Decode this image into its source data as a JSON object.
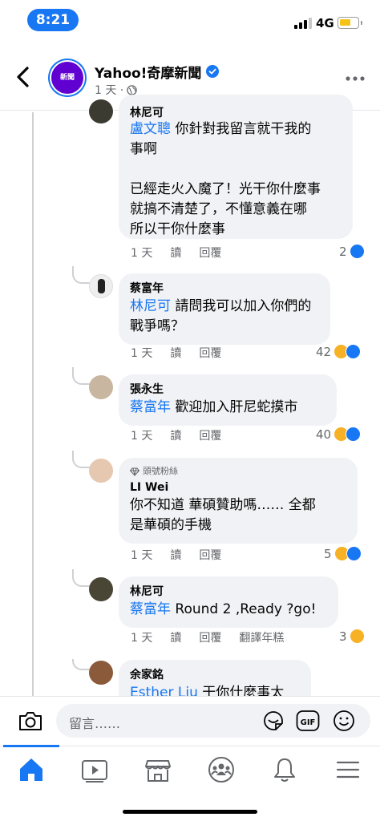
{
  "status_bar": {
    "time": "8:21",
    "network": "4G"
  },
  "header": {
    "page_name": "Yahoo!奇摩新聞",
    "avatar_text": "新聞",
    "meta": "1 天 ·"
  },
  "comments": [
    {
      "author_partial": "林尼可",
      "mention": "盧文聰",
      "text": " 你針對我留言就干我的\n事啊\n\n已經走火入魔了！光干你什麼事\n就搞不清楚了，不懂意義在哪\n所以干你什麼事",
      "time": "1 天",
      "read": "讀",
      "reply": "回覆",
      "count": "2"
    },
    {
      "author": "蔡富年",
      "mention": "林尼可",
      "text": " 請問我可以加入你們的\n戰爭嗎？",
      "time": "1 天",
      "read": "讀",
      "reply": "回覆",
      "count": "42"
    },
    {
      "author": "張永生",
      "mention": "蔡富年",
      "text": " 歡迎加入肝尼蛇摸市",
      "time": "1 天",
      "read": "讀",
      "reply": "回覆",
      "count": "40"
    },
    {
      "badge": "頭號粉絲",
      "author": "LI Wei",
      "text": "你不知道 華碩贊助嗎…… 全都\n是華碩的手機",
      "time": "1 天",
      "read": "讀",
      "reply": "回覆",
      "count": "5"
    },
    {
      "author": "林尼可",
      "mention": "蔡富年",
      "text": " Round 2 ,Ready ?go!",
      "time": "1 天",
      "read": "讀",
      "reply": "回覆",
      "translate": "翻譯年糕",
      "count": "3"
    },
    {
      "author": "余家銘",
      "mention": "Esther Liu",
      "text": " 干你什麼事太"
    }
  ],
  "composer": {
    "placeholder": "留言……",
    "gif_label": "GIF"
  },
  "nav": {
    "items": [
      "home-icon",
      "video-icon",
      "marketplace-icon",
      "groups-icon",
      "notifications-icon",
      "menu-icon"
    ]
  },
  "colors": {
    "accent": "#1877f2",
    "bubble": "#f0f2f5",
    "secondary_text": "#65676b"
  }
}
